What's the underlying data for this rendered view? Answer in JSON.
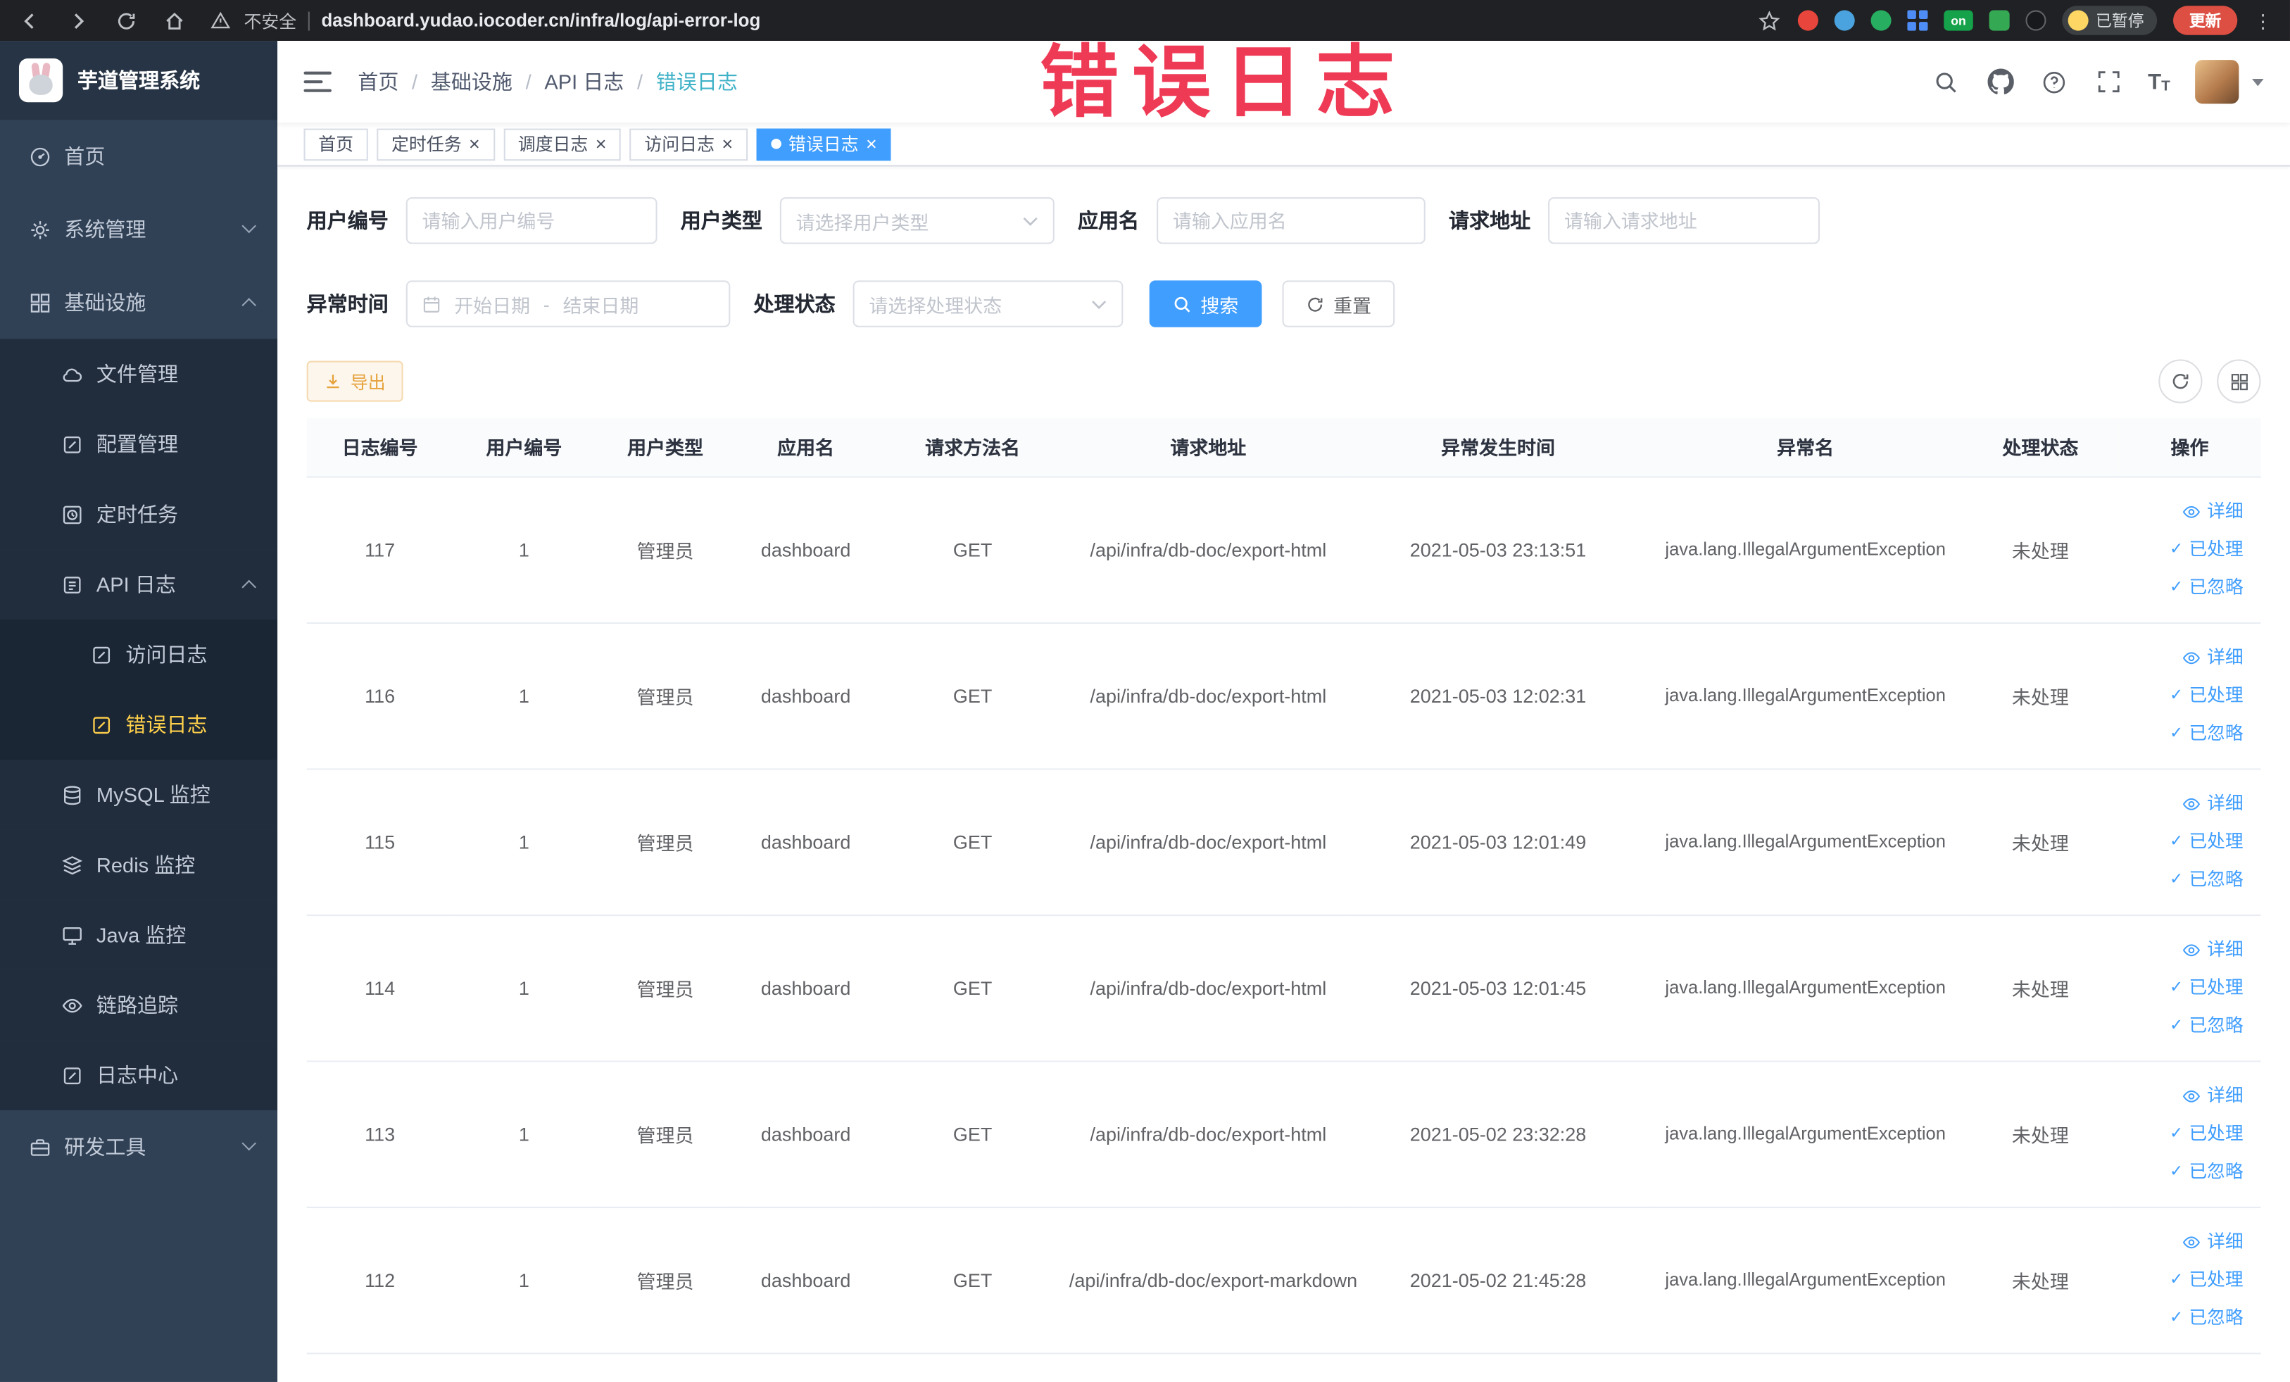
{
  "colors": {
    "primary": "#409eff",
    "sidebar_bg": "#304156",
    "sidebar_submenu_bg": "#212d3d",
    "sidebar_active_text": "#ffd04b",
    "active_tag_bg": "#409eff",
    "export_warning": "#e6a23c",
    "annotation_red": "#ef3a55"
  },
  "annotation": {
    "text": "错误日志"
  },
  "browser": {
    "security_label": "不安全",
    "url": "dashboard.yudao.iocoder.cn/infra/log/api-error-log",
    "extension_on_label": "on",
    "paused_badge": "已暂停",
    "update_button": "更新"
  },
  "sidebar": {
    "logo_title": "芋道管理系统",
    "items": [
      {
        "label": "首页"
      },
      {
        "label": "系统管理"
      },
      {
        "label": "基础设施"
      },
      {
        "label": "文件管理"
      },
      {
        "label": "配置管理"
      },
      {
        "label": "定时任务"
      },
      {
        "label": "API 日志"
      },
      {
        "label": "访问日志"
      },
      {
        "label": "错误日志"
      },
      {
        "label": "MySQL 监控"
      },
      {
        "label": "Redis 监控"
      },
      {
        "label": "Java 监控"
      },
      {
        "label": "链路追踪"
      },
      {
        "label": "日志中心"
      },
      {
        "label": "研发工具"
      }
    ]
  },
  "breadcrumb": {
    "items": [
      "首页",
      "基础设施",
      "API 日志",
      "错误日志"
    ]
  },
  "tags": {
    "items": [
      {
        "label": "首页"
      },
      {
        "label": "定时任务"
      },
      {
        "label": "调度日志"
      },
      {
        "label": "访问日志"
      },
      {
        "label": "错误日志"
      }
    ]
  },
  "filters": {
    "user_id": {
      "label": "用户编号",
      "placeholder": "请输入用户编号"
    },
    "user_type": {
      "label": "用户类型",
      "placeholder": "请选择用户类型"
    },
    "app_name": {
      "label": "应用名",
      "placeholder": "请输入应用名"
    },
    "request_url": {
      "label": "请求地址",
      "placeholder": "请输入请求地址"
    },
    "exception_time": {
      "label": "异常时间",
      "start_placeholder": "开始日期",
      "separator": "-",
      "end_placeholder": "结束日期"
    },
    "process_status": {
      "label": "处理状态",
      "placeholder": "请选择处理状态"
    },
    "search_label": "搜索",
    "reset_label": "重置"
  },
  "toolbar": {
    "export_label": "导出"
  },
  "table": {
    "columns": [
      "日志编号",
      "用户编号",
      "用户类型",
      "应用名",
      "请求方法名",
      "请求地址",
      "异常发生时间",
      "异常名",
      "处理状态",
      "操作"
    ],
    "row_actions": {
      "detail": "详细",
      "processed": "已处理",
      "ignored": "已忽略"
    },
    "rows": [
      {
        "log_id": "117",
        "user_id": "1",
        "user_type": "管理员",
        "app_name": "dashboard",
        "method": "GET",
        "url": "/api/infra/db-doc/export-html",
        "time": "2021-05-03 23:13:51",
        "exception": "java.lang.IllegalArgumentException",
        "status": "未处理"
      },
      {
        "log_id": "116",
        "user_id": "1",
        "user_type": "管理员",
        "app_name": "dashboard",
        "method": "GET",
        "url": "/api/infra/db-doc/export-html",
        "time": "2021-05-03 12:02:31",
        "exception": "java.lang.IllegalArgumentException",
        "status": "未处理"
      },
      {
        "log_id": "115",
        "user_id": "1",
        "user_type": "管理员",
        "app_name": "dashboard",
        "method": "GET",
        "url": "/api/infra/db-doc/export-html",
        "time": "2021-05-03 12:01:49",
        "exception": "java.lang.IllegalArgumentException",
        "status": "未处理"
      },
      {
        "log_id": "114",
        "user_id": "1",
        "user_type": "管理员",
        "app_name": "dashboard",
        "method": "GET",
        "url": "/api/infra/db-doc/export-html",
        "time": "2021-05-03 12:01:45",
        "exception": "java.lang.IllegalArgumentException",
        "status": "未处理"
      },
      {
        "log_id": "113",
        "user_id": "1",
        "user_type": "管理员",
        "app_name": "dashboard",
        "method": "GET",
        "url": "/api/infra/db-doc/export-html",
        "time": "2021-05-02 23:32:28",
        "exception": "java.lang.IllegalArgumentException",
        "status": "未处理"
      },
      {
        "log_id": "112",
        "user_id": "1",
        "user_type": "管理员",
        "app_name": "dashboard",
        "method": "GET",
        "url": "/api/infra/db-doc/export-markdown",
        "time": "2021-05-02 21:45:28",
        "exception": "java.lang.IllegalArgumentException",
        "status": "未处理"
      }
    ]
  }
}
